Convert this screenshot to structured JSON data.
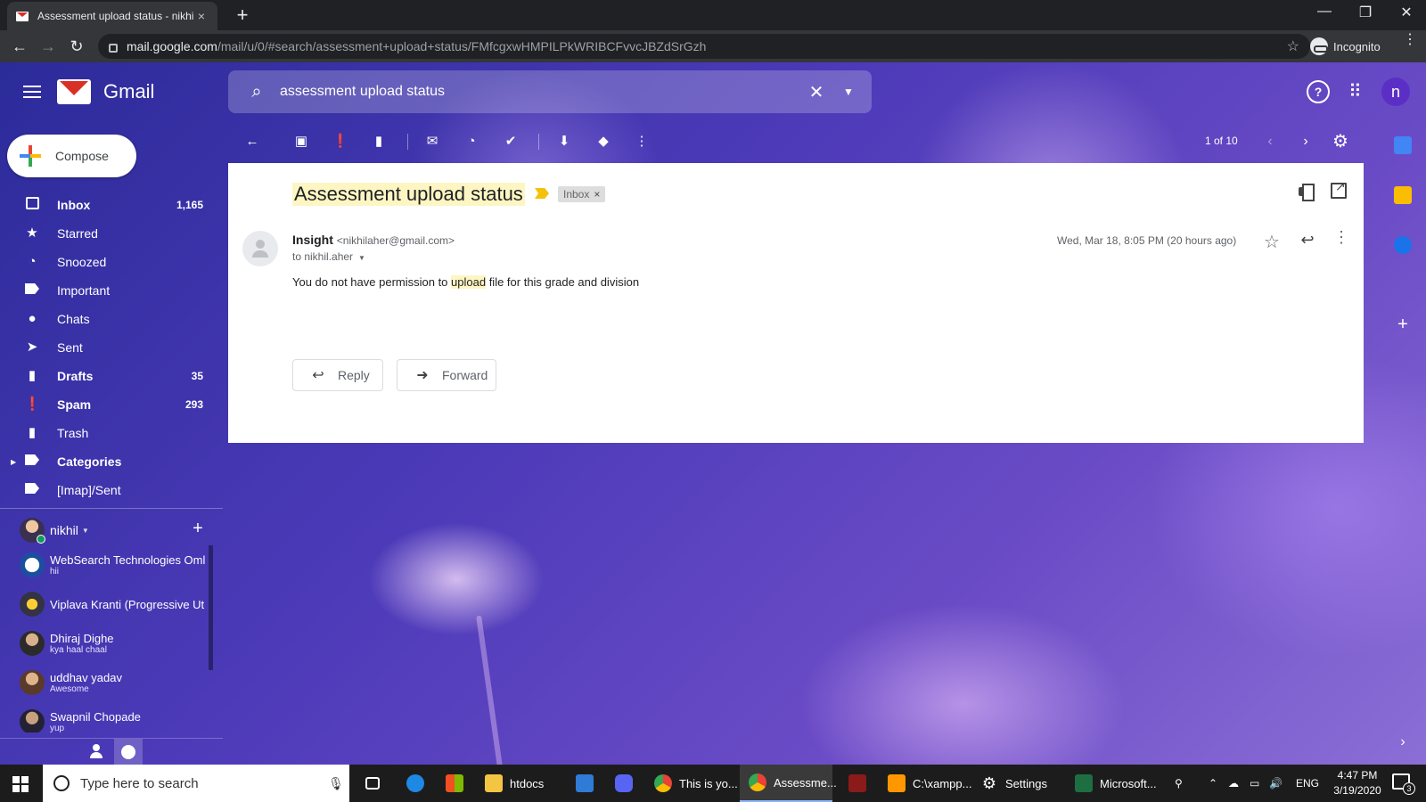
{
  "browser": {
    "tab_title": "Assessment upload status - nikhil",
    "tab_close": "×",
    "new_tab": "+",
    "url_host": "mail.google.com",
    "url_path": "/mail/u/0/#search/assessment+upload+status/FMfcgxwHMPILPkWRIBCFvvcJBZdSrGzh",
    "incognito_label": "Incognito",
    "minimize": "—",
    "restore": "❐",
    "close": "✕"
  },
  "gmail": {
    "logo_text": "Gmail",
    "search_value": "assessment upload status",
    "avatar_letter": "n",
    "compose_label": "Compose"
  },
  "nav": {
    "items": [
      {
        "label": "Inbox",
        "count": "1,165",
        "icon": "inbox-icon",
        "bold": true
      },
      {
        "label": "Starred",
        "count": "",
        "icon": "star-icon",
        "bold": false
      },
      {
        "label": "Snoozed",
        "count": "",
        "icon": "clock-icon",
        "bold": false
      },
      {
        "label": "Important",
        "count": "",
        "icon": "important-icon",
        "bold": false
      },
      {
        "label": "Chats",
        "count": "",
        "icon": "chat-icon",
        "bold": false
      },
      {
        "label": "Sent",
        "count": "",
        "icon": "send-icon",
        "bold": false
      },
      {
        "label": "Drafts",
        "count": "35",
        "icon": "draft-icon",
        "bold": true
      },
      {
        "label": "Spam",
        "count": "293",
        "icon": "spam-icon",
        "bold": true
      },
      {
        "label": "Trash",
        "count": "",
        "icon": "trash-icon",
        "bold": false
      },
      {
        "label": "Categories",
        "count": "",
        "icon": "label-icon",
        "bold": true
      },
      {
        "label": "[Imap]/Sent",
        "count": "",
        "icon": "label-icon",
        "bold": false
      }
    ]
  },
  "hangouts": {
    "user": "nikhil",
    "contacts": [
      {
        "name": "WebSearch Technologies Oml",
        "msg": "hii"
      },
      {
        "name": "Viplava Kranti (Progressive Ut",
        "msg": ""
      },
      {
        "name": "Dhiraj Dighe",
        "msg": "kya haal chaal"
      },
      {
        "name": "uddhav yadav",
        "msg": "Awesome"
      },
      {
        "name": "Swapnil Chopade",
        "msg": "yup"
      }
    ]
  },
  "toolbar": {
    "pager": "1 of 10"
  },
  "message": {
    "subject": "Assessment upload status",
    "label_chip": "Inbox",
    "sender_name": "Insight",
    "sender_email": "<nikhilaher@gmail.com>",
    "to": "to nikhil.aher",
    "date": "Wed, Mar 18, 8:05 PM (20 hours ago)",
    "body_before": "You do not have permission to ",
    "body_highlight": "upload",
    "body_after": " file for this grade and division",
    "reply_label": "Reply",
    "forward_label": "Forward"
  },
  "taskbar": {
    "search_placeholder": "Type here to search",
    "apps": [
      {
        "label": "htdocs"
      },
      {
        "label": "This is yo..."
      },
      {
        "label": "Assessme..."
      },
      {
        "label": "C:\\xampp..."
      },
      {
        "label": "Settings"
      },
      {
        "label": "Microsoft..."
      }
    ],
    "lang": "ENG",
    "time": "4:47 PM",
    "date": "3/19/2020",
    "notification_count": "3"
  }
}
